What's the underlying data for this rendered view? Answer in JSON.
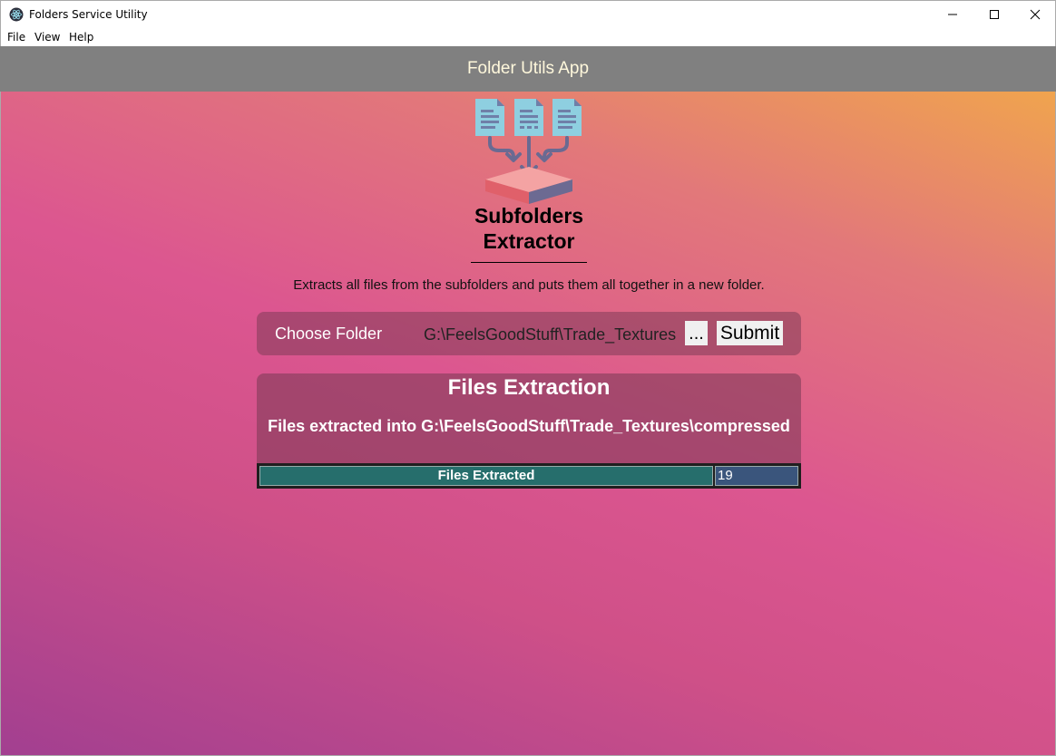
{
  "window": {
    "title": "Folders Service Utility",
    "icon": "electron-atom-icon"
  },
  "menu": {
    "items": [
      "File",
      "View",
      "Help"
    ]
  },
  "header": {
    "title": "Folder Utils App"
  },
  "tool": {
    "logo_icon": "files-merge-into-tray-icon",
    "name_line1": "Subfolders",
    "name_line2": "Extractor",
    "description": "Extracts all files from the subfolders and puts them all together in a new folder."
  },
  "chooser": {
    "label": "Choose Folder",
    "path": "G:\\FeelsGoodStuff\\Trade_Textures",
    "browse_label": "...",
    "submit_label": "Submit"
  },
  "extraction": {
    "title": "Files Extraction",
    "message": "Files extracted into G:\\FeelsGoodStuff\\Trade_Textures\\compressed",
    "table": {
      "label": "Files Extracted",
      "value": "19"
    }
  },
  "colors": {
    "header_bg": "#808080",
    "header_text": "#fff8dc",
    "label_cell": "#266e6c",
    "value_cell": "#3a557c"
  }
}
